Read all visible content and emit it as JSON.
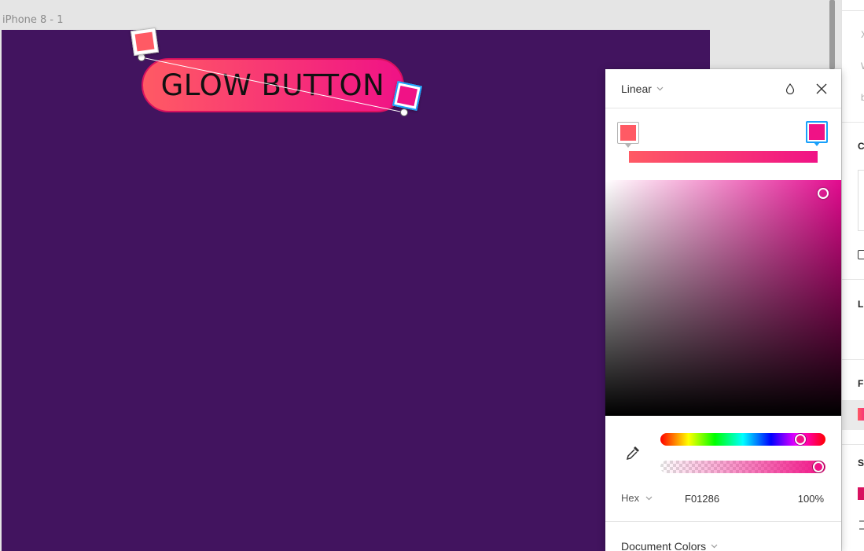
{
  "canvas": {
    "frame_label": "iPhone 8 - 1",
    "frame_color": "#42145f",
    "button_text": "GLOW BUTTON"
  },
  "gradient": {
    "start_color": "#ff5a64",
    "end_color": "#f01286"
  },
  "picker": {
    "type_label": "Linear",
    "format_label": "Hex",
    "hex_value": "F01286",
    "opacity_value": "100%",
    "document_colors_label": "Document Colors",
    "hue_fraction": 0.88,
    "alpha_fraction": 1.0,
    "icons": {
      "drop": "drop-icon",
      "close": "close-icon",
      "eyedropper": "eyedropper-icon",
      "chevron": "chevron-down-icon"
    }
  },
  "right_panel": {
    "labels": [
      "X",
      "W",
      "b",
      "C",
      "L",
      "F",
      "S"
    ],
    "fill_color": "#ff5a64",
    "stroke_color": "#d8115f"
  }
}
